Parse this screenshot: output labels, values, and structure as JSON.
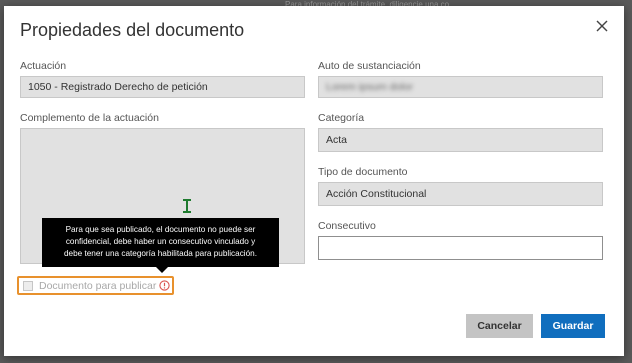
{
  "backdrop": {
    "text": "Para información del trámite, diligencie una co..."
  },
  "dialog": {
    "title": "Propiedades del documento",
    "close_icon": "close-icon"
  },
  "form": {
    "actuacion": {
      "label": "Actuación",
      "value": "1050 - Registrado Derecho de petición"
    },
    "auto": {
      "label": "Auto de sustanciación",
      "value": "Lorem ipsum dolor"
    },
    "complemento": {
      "label": "Complemento de la actuación",
      "value": ""
    },
    "categoria": {
      "label": "Categoría",
      "value": "Acta"
    },
    "tipo": {
      "label": "Tipo de documento",
      "value": "Acción Constitucional"
    },
    "consecutivo": {
      "label": "Consecutivo",
      "value": ""
    },
    "publicar": {
      "label": "Documento para publicar",
      "checked": false,
      "icon": "warning-circle-icon"
    }
  },
  "tooltip": {
    "line1": "Para que sea publicado, el documento no puede ser",
    "line2": "confidencial, debe haber un consecutivo vinculado y",
    "line3": "debe tener una categoría habilitada para publicación."
  },
  "buttons": {
    "cancel": "Cancelar",
    "save": "Guardar"
  },
  "colors": {
    "primary": "#106ebe",
    "warning": "#e8912d",
    "warning_icon": "#d9534f"
  }
}
